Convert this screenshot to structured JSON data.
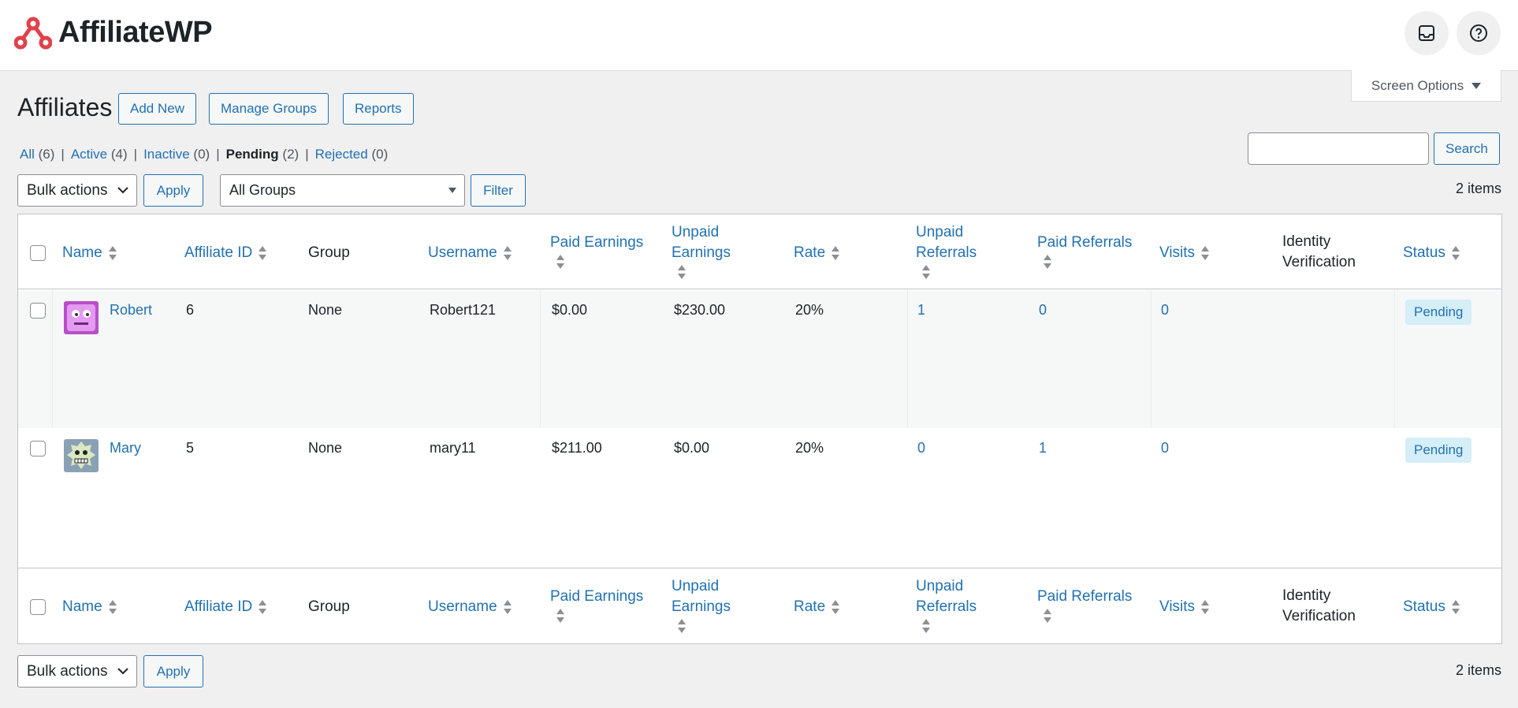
{
  "brand": {
    "name": "AffiliateWP",
    "accent": "#e0424b"
  },
  "top_icons": [
    "inbox-icon",
    "help-icon"
  ],
  "screen_options": "Screen Options",
  "page": {
    "title": "Affiliates",
    "buttons": {
      "add_new": "Add New",
      "manage_groups": "Manage Groups",
      "reports": "Reports"
    }
  },
  "views": [
    {
      "label": "All",
      "count": "(6)"
    },
    {
      "label": "Active",
      "count": "(4)"
    },
    {
      "label": "Inactive",
      "count": "(0)"
    },
    {
      "label": "Pending",
      "count": "(2)",
      "current": true
    },
    {
      "label": "Rejected",
      "count": "(0)"
    }
  ],
  "search": {
    "button": "Search",
    "value": ""
  },
  "tablenav": {
    "bulk_actions": "Bulk actions",
    "apply": "Apply",
    "groups_select": "All Groups",
    "filter": "Filter",
    "items_count": "2 items"
  },
  "columns": {
    "name": "Name",
    "affiliate_id": "Affiliate ID",
    "group": "Group",
    "username": "Username",
    "paid_earnings": "Paid Earnings",
    "unpaid_earnings_1": "Unpaid",
    "unpaid_earnings_2": "Earnings",
    "rate": "Rate",
    "unpaid_referrals_1": "Unpaid",
    "unpaid_referrals_2": "Referrals",
    "paid_referrals": "Paid Referrals",
    "visits": "Visits",
    "identity_1": "Identity",
    "identity_2": "Verification",
    "status": "Status"
  },
  "rows": [
    {
      "name": "Robert",
      "id": "6",
      "group": "None",
      "username": "Robert121",
      "paid": "$0.00",
      "unpaid": "$230.00",
      "rate": "20%",
      "unpaid_refs": "1",
      "paid_refs": "0",
      "visits": "0",
      "status": "Pending",
      "avatar": "purple-face-avatar"
    },
    {
      "name": "Mary",
      "id": "5",
      "group": "None",
      "username": "mary11",
      "paid": "$211.00",
      "unpaid": "$0.00",
      "rate": "20%",
      "unpaid_refs": "0",
      "paid_refs": "1",
      "visits": "0",
      "status": "Pending",
      "avatar": "green-monster-avatar"
    }
  ],
  "colors": {
    "link": "#2271b1",
    "badge_bg": "#d5eef7",
    "page_bg": "#f0f0f1"
  }
}
